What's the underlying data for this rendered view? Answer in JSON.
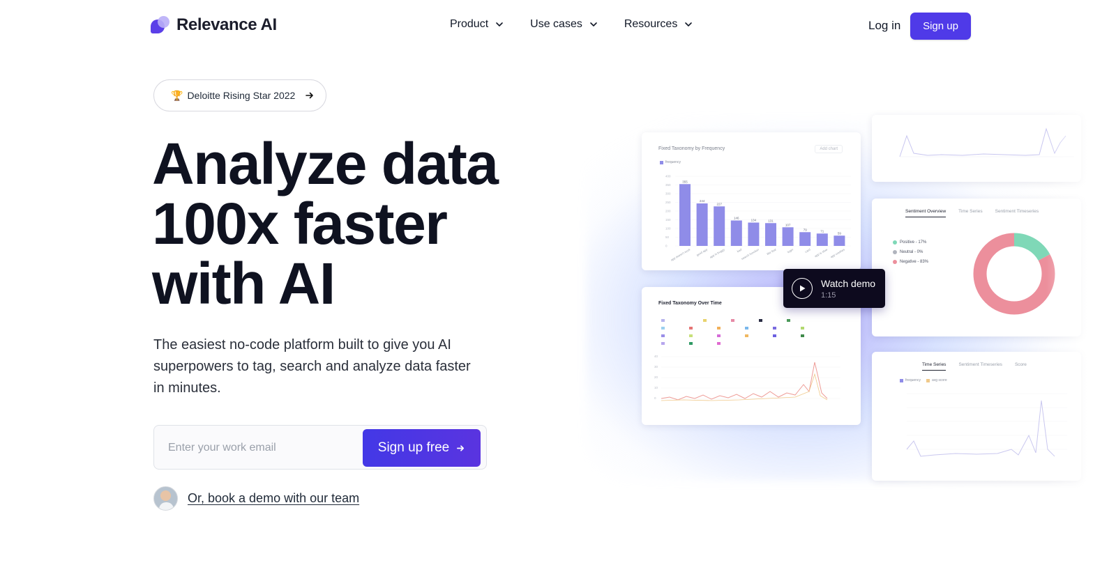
{
  "nav": {
    "logo_text": "Relevance AI",
    "menu": [
      {
        "label": "Product"
      },
      {
        "label": "Use cases"
      },
      {
        "label": "Resources"
      }
    ],
    "login_label": "Log in",
    "signup_label": "Sign up"
  },
  "hero": {
    "badge_emoji": "🏆",
    "badge_text": "Deloitte Rising Star 2022",
    "headline_lines": [
      "Analyze data",
      "100x faster",
      "with AI"
    ],
    "subtext": "The easiest no-code platform built to give you AI superpowers to tag, search and analyze data faster in minutes.",
    "email_placeholder": "Enter your work email",
    "cta_label": "Sign up free",
    "demo_link": "Or, book a demo with our team"
  },
  "dashboard": {
    "bar_card_title": "Fixed Taxonomy by Frequency",
    "bar_card_button": "Add chart",
    "bar_card_legend": "frequency",
    "bar_values": [
      355,
      244,
      227,
      146,
      134,
      131,
      107,
      79,
      71,
      59
    ],
    "bar_categories": [
      "app doesn't work",
      "good app",
      "app is buggy",
      "bad",
      "search function",
      "like feat",
      "login",
      "card",
      "app is slow",
      "app crashes"
    ],
    "time_card_title": "Fixed Taxonomy Over Time",
    "sentiment_tabs": [
      "Sentiment Overview",
      "Time Series",
      "Sentiment Timeseries"
    ],
    "sentiment_legend": [
      {
        "label": "Positive - 17%",
        "color": "#7fd8b7"
      },
      {
        "label": "Neutral - 0%",
        "color": "#b0b4bd"
      },
      {
        "label": "Negative - 83%",
        "color": "#ec8f9c"
      }
    ],
    "donut": {
      "positive": 17,
      "neutral": 0,
      "negative": 83
    },
    "timeseries_tabs": [
      "Time Series",
      "Sentiment Timeseries",
      "Score"
    ],
    "timeseries_legend": [
      "frequency",
      "avg score"
    ],
    "watch_demo_label": "Watch demo",
    "watch_demo_duration": "1:15"
  },
  "colors": {
    "brand": "#4f3ae8",
    "bar": "#8f8ce8",
    "positive": "#7fd8b7",
    "negative": "#ec8f9c",
    "dark": "#0d0a1e"
  }
}
